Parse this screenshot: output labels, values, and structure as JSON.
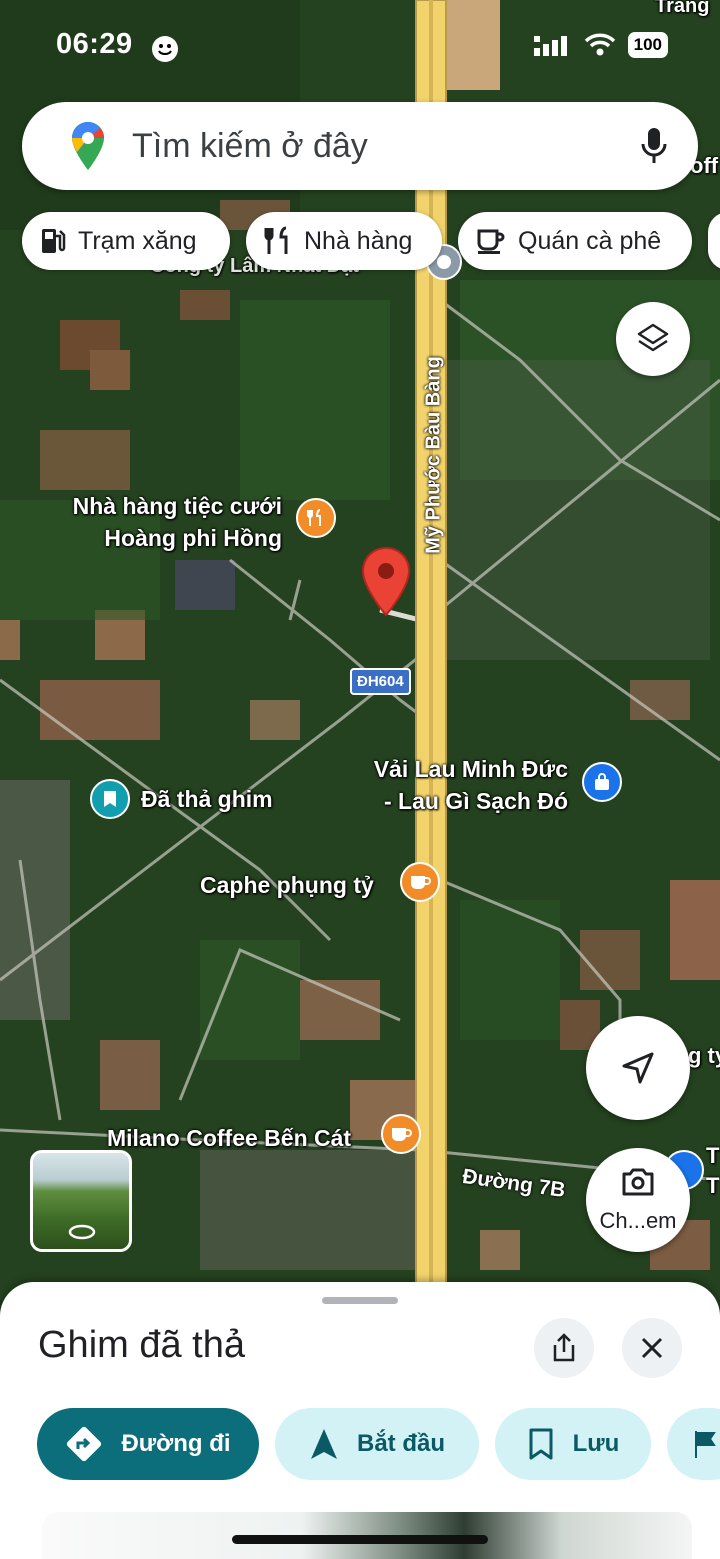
{
  "status_bar": {
    "time": "06:29",
    "battery": "100",
    "icons": [
      "smiley-icon",
      "signal-icon",
      "wifi-icon",
      "battery-icon"
    ]
  },
  "search": {
    "placeholder": "Tìm kiếm ở đây",
    "icons": [
      "google-maps-logo",
      "mic-icon"
    ]
  },
  "chips": [
    {
      "label": "Trạm xăng",
      "icon": "gas-station-icon"
    },
    {
      "label": "Nhà hàng",
      "icon": "restaurant-icon"
    },
    {
      "label": "Quán cà phê",
      "icon": "coffee-icon"
    }
  ],
  "map": {
    "labels": {
      "restaurant_line1": "Nhà hàng tiệc cưới",
      "restaurant_line2": "Hoàng phi Hồng",
      "shop_line1": "Vải Lau Minh Đức",
      "shop_line2": "- Lau Gì Sạch Đó",
      "dropped_pin": "Đã thả ghim",
      "cafe1": "Caphe phụng tỷ",
      "cafe2": "Milano Coffee Bến Cát",
      "company_partial": "Công ty Lâm Nhất Đạt",
      "top_right_partial": "Trang",
      "right_partial_1": "off",
      "right_partial_2": "g ty",
      "right_partial_3": "T",
      "right_partial_4": "T"
    },
    "roads": {
      "main": "Mỹ Phước Bàu Bàng",
      "route_shield": "ĐH604",
      "road_7b": "Đường 7B"
    },
    "colors": {
      "forest": "#24421f",
      "road": "#e8c46a",
      "pin": "#ea4335",
      "poi_orange": "#f28c28",
      "poi_teal": "#129eaf"
    }
  },
  "controls": {
    "layers_icon": "layers-icon",
    "location_icon": "navigation-arrow-icon",
    "camera_label": "Ch...em"
  },
  "sheet": {
    "title": "Ghim đã thả",
    "share_icon": "share-icon",
    "close_icon": "close-icon",
    "actions": [
      {
        "label": "Đường đi",
        "icon": "directions-icon"
      },
      {
        "label": "Bắt đầu",
        "icon": "navigation-icon"
      },
      {
        "label": "Lưu",
        "icon": "bookmark-icon"
      }
    ]
  }
}
